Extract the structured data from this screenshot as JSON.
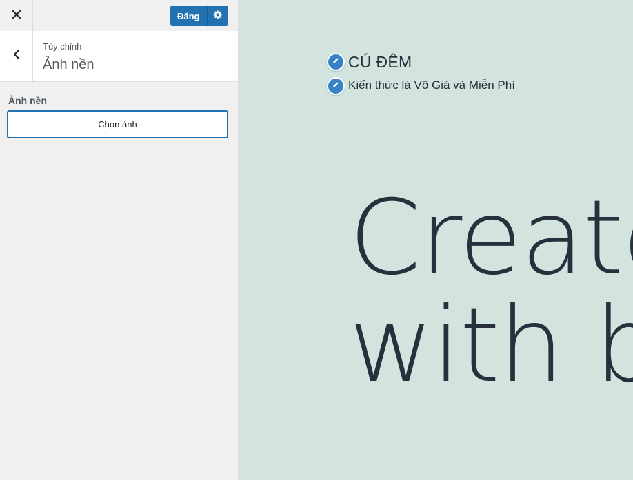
{
  "topbar": {
    "close_icon": "close-icon",
    "publish_label": "Đăng",
    "settings_icon": "gear-icon"
  },
  "section": {
    "back_icon": "chevron-left-icon",
    "breadcrumb": "Tùy chỉnh",
    "title": "Ảnh nền"
  },
  "control": {
    "label": "Ảnh nền",
    "choose_button": "Chọn ảnh"
  },
  "preview": {
    "background_color": "#d3e4df",
    "edit_icon": "pencil-icon",
    "site_title": "CÚ ĐÊM",
    "tagline": "Kiến thức là Vô Giá và Miễn Phí",
    "hero_line1": "Create",
    "hero_line2": "with blo"
  },
  "colors": {
    "accent": "#2271b1",
    "edit_shortcut": "#3582c4",
    "text_dark": "#28303d"
  }
}
